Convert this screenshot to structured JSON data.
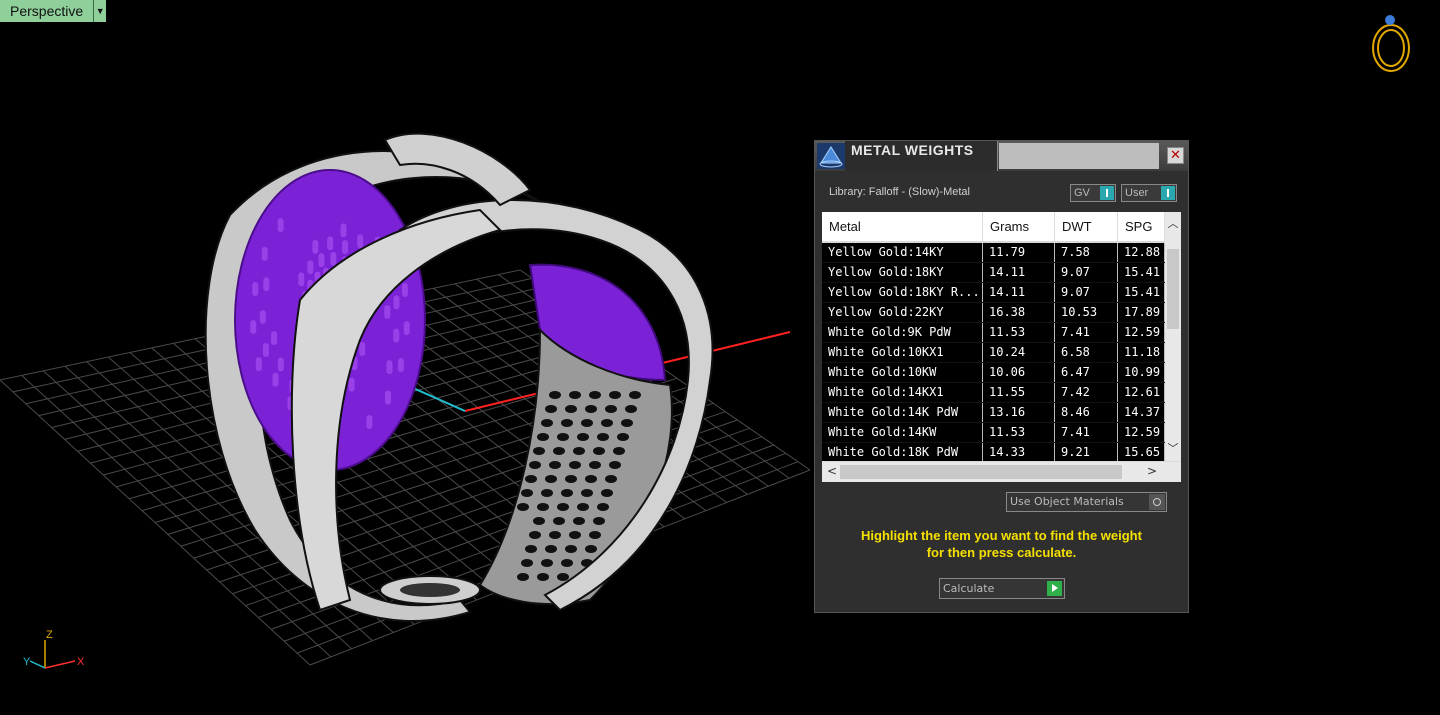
{
  "viewport": {
    "label": "Perspective",
    "axis_labels": {
      "z": "Z",
      "y": "Y",
      "x": "X"
    },
    "colors": {
      "ring_metal": "#c9c9c9",
      "stones": "#8a2be2",
      "grid": "#555555",
      "x_axis": "#ff2020",
      "y_axis": "#20c0d0",
      "nav_ring": "#e0a800"
    }
  },
  "dialog": {
    "title": "METAL WEIGHTS",
    "close_icon": "close-icon",
    "library_label": "Library: Falloff - (Slow)-Metal",
    "toggles": [
      {
        "label": "GV"
      },
      {
        "label": "User"
      }
    ],
    "table": {
      "columns": [
        "Metal",
        "Grams",
        "DWT",
        "SPG"
      ],
      "rows": [
        [
          "Yellow Gold:14KY",
          "11.79",
          "7.58",
          "12.88"
        ],
        [
          "Yellow Gold:18KY",
          "14.11",
          "9.07",
          "15.41"
        ],
        [
          "Yellow Gold:18KY R...",
          "14.11",
          "9.07",
          "15.41"
        ],
        [
          "Yellow Gold:22KY",
          "16.38",
          "10.53",
          "17.89"
        ],
        [
          "White Gold:9K PdW",
          "11.53",
          "7.41",
          "12.59"
        ],
        [
          "White Gold:10KX1",
          "10.24",
          "6.58",
          "11.18"
        ],
        [
          "White Gold:10KW",
          "10.06",
          "6.47",
          "10.99"
        ],
        [
          "White Gold:14KX1",
          "11.55",
          "7.42",
          "12.61"
        ],
        [
          "White Gold:14K PdW",
          "13.16",
          "8.46",
          "14.37"
        ],
        [
          "White Gold:14KW",
          "11.53",
          "7.41",
          "12.59"
        ],
        [
          "White Gold:18K PdW",
          "14.33",
          "9.21",
          "15.65"
        ]
      ]
    },
    "use_object_materials_label": "Use Object Materials",
    "hint_line1": "Highlight the item you want to find the weight",
    "hint_line2": "for then press calculate.",
    "calculate_label": "Calculate"
  }
}
